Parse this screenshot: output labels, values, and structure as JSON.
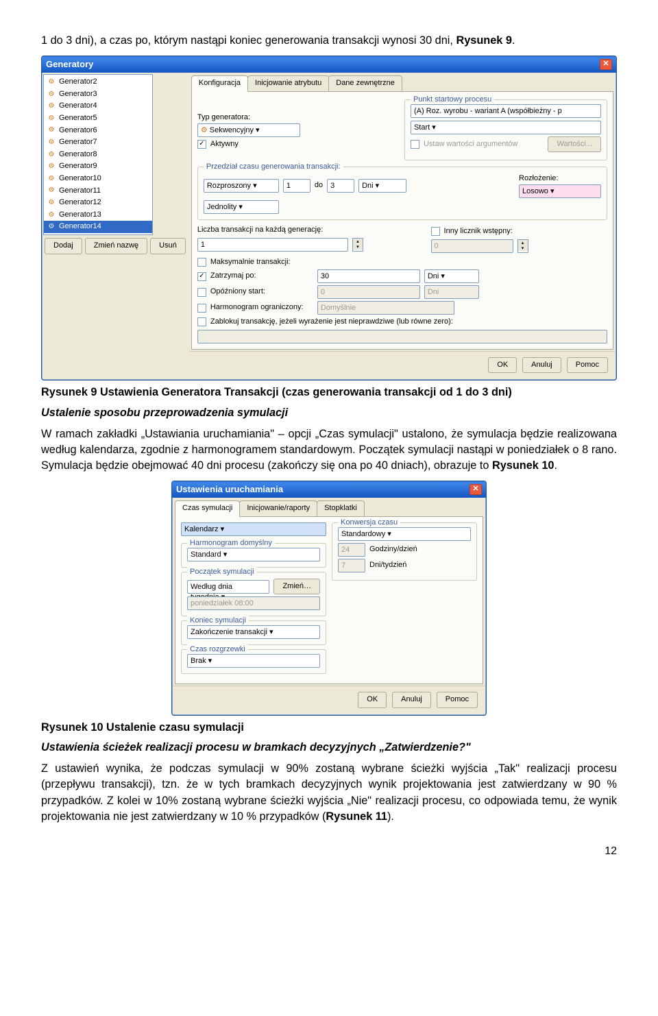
{
  "intro": "1 do 3 dni), a czas po, którym nastąpi koniec generowania transakcji wynosi 30 dni, ",
  "ref9": "Rysunek 9",
  "intro_end": ".",
  "dlg1": {
    "title": "Generatory",
    "list": {
      "items": [
        "Generator2",
        "Generator3",
        "Generator4",
        "Generator5",
        "Generator6",
        "Generator7",
        "Generator8",
        "Generator9",
        "Generator10",
        "Generator11",
        "Generator12",
        "Generator13",
        "Generator14"
      ],
      "selected": "Generator14"
    },
    "list_buttons": {
      "add": "Dodaj",
      "rename": "Zmień nazwę",
      "del": "Usuń"
    },
    "tabs": {
      "t1": "Konfiguracja",
      "t2": "Inicjowanie atrybutu",
      "t3": "Dane zewnętrzne"
    },
    "fields": {
      "type_label": "Typ generatora:",
      "type_value": "Sekwencyjny",
      "start_label": "Punkt startowy procesu",
      "start_value": "(A) Roz. wyrobu - wariant A (współbieżny - p",
      "start2": "Start",
      "active": "Aktywny",
      "ustaw_arg": "Ustaw wartości argumentów",
      "wartosci": "Wartości...",
      "interval_label": "Przedział czasu generowania transakcji:",
      "interval_mode": "Rozproszony",
      "interval_from": "1",
      "do": "do",
      "interval_to": "3",
      "unit": "Dni",
      "roz_label": "Rozłożenie:",
      "roz_value": "Losowo",
      "jednolity": "Jednolity",
      "liczba_label": "Liczba transakcji na każdą generację:",
      "liczba_value": "1",
      "inny_label": "Inny licznik wstępny:",
      "inny_value": "0",
      "max": "Maksymalnie transakcji:",
      "stop": "Zatrzymaj po:",
      "stop_val": "30",
      "stop_unit": "Dni",
      "opoz": "Opóźniony start:",
      "opoz_val": "0",
      "opoz_unit": "Dni",
      "harm": "Harmonogram ograniczony:",
      "harm_val": "Domyślnie",
      "zablokuj": "Zablokuj transakcję, jeżeli wyrażenie jest nieprawdziwe (lub równe zero):"
    },
    "buttons": {
      "ok": "OK",
      "cancel": "Anuluj",
      "help": "Pomoc"
    }
  },
  "cap1": "Rysunek 9 Ustawienia Generatora Transakcji (czas generowania transakcji od 1 do 3 dni)",
  "sec1_title": "Ustalenie sposobu przeprowadzenia symulacji",
  "para2a": "W ramach zakładki „Ustawiania uruchamiania\" – opcji „Czas symulacji\" ustalono, że symulacja będzie realizowana według kalendarza, zgodnie z harmonogramem standardowym. Początek symulacji nastąpi w poniedziałek o 8 rano. Symulacja będzie obejmować 40 dni procesu (zakończy się ona po 40 dniach), obrazuje to ",
  "ref10": "Rysunek 10",
  "dlg2": {
    "title": "Ustawienia uruchamiania",
    "tabs": {
      "t1": "Czas symulacji",
      "t2": "Inicjowanie/raporty",
      "t3": "Stopklatki"
    },
    "left": {
      "kal": "Kalendarz",
      "harm_label": "Harmonogram domyślny",
      "harm_value": "Standard",
      "start_label": "Początek symulacji",
      "start_mode": "Według dnia tygodnia",
      "zmien": "Zmień…",
      "start_val": "poniedziałek 08:00",
      "end_label": "Koniec symulacji",
      "end_val": "Zakończenie transakcji",
      "roz_label": "Czas rozgrzewki",
      "roz_val": "Brak"
    },
    "right": {
      "konw_label": "Konwersja czasu",
      "konw_val": "Standardowy",
      "gdz": "24",
      "gdz_lbl": "Godziny/dzień",
      "dni": "7",
      "dni_lbl": "Dni/tydzień"
    },
    "buttons": {
      "ok": "OK",
      "cancel": "Anuluj",
      "help": "Pomoc"
    }
  },
  "cap2": "Rysunek 10 Ustalenie czasu symulacji",
  "sec2_title": "Ustawienia ścieżek realizacji procesu w bramkach decyzyjnych „Zatwierdzenie?\"",
  "para3a": "Z ustawień wynika, że podczas symulacji w 90% zostaną wybrane ścieżki wyjścia „Tak\" realizacji procesu (przepływu transakcji), tzn. że w tych bramkach decyzyjnych wynik projektowania jest zatwierdzany w 90 % przypadków. Z kolei w 10% zostaną wybrane ścieżki wyjścia  „Nie\" realizacji procesu, co odpowiada temu, że wynik projektowania nie jest zatwierdzany w 10 % przypadków (",
  "ref11": "Rysunek 11",
  "para3b": ").",
  "pagenum": "12"
}
